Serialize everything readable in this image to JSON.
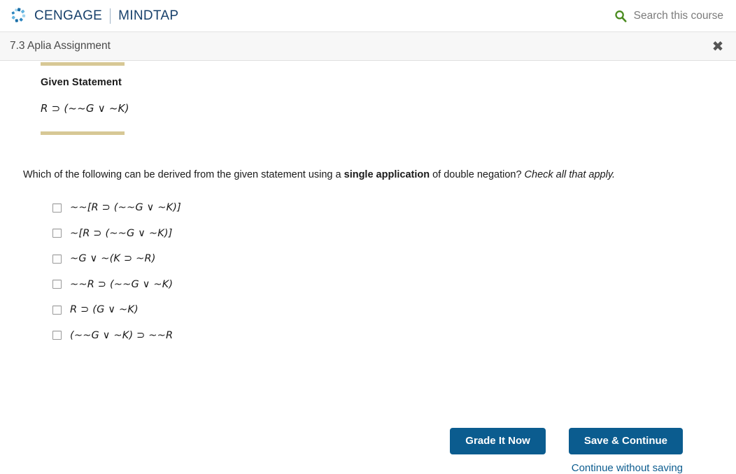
{
  "header": {
    "brand_primary": "CENGAGE",
    "brand_secondary": "MINDTAP",
    "logo_icon": "cengage-swirl-icon",
    "search_icon": "search-icon",
    "search_label": "Search this course",
    "search_icon_color": "#4a8b1f"
  },
  "assignment": {
    "title": "7.3 Aplia Assignment",
    "close_icon": "close-icon"
  },
  "given": {
    "heading": "Given Statement",
    "formula": "R ⊃ (~~G ∨ ~K)",
    "rule_color": "#d7c895"
  },
  "question": {
    "prefix": "Which of the following can be derived from the given statement using a ",
    "bold": "single application",
    "middle": " of double negation? ",
    "italic": "Check all that apply."
  },
  "options": [
    {
      "id": "option-1",
      "text": "~~[R ⊃ (~~G ∨ ~K)]",
      "checked": false
    },
    {
      "id": "option-2",
      "text": "~[R ⊃ (~~G ∨ ~K)]",
      "checked": false
    },
    {
      "id": "option-3",
      "text": "~G ∨ ~(K ⊃ ~R)",
      "checked": false
    },
    {
      "id": "option-4",
      "text": "~~R ⊃ (~~G ∨ ~K)",
      "checked": false
    },
    {
      "id": "option-5",
      "text": "R ⊃ (G ∨ ~K)",
      "checked": false
    },
    {
      "id": "option-6",
      "text": "(~~G ∨ ~K) ⊃ ~~R",
      "checked": false
    }
  ],
  "footer": {
    "grade_label": "Grade It Now",
    "save_label": "Save & Continue",
    "continue_link": "Continue without saving",
    "button_color": "#0b5c8f",
    "link_color": "#0b5c8f"
  }
}
